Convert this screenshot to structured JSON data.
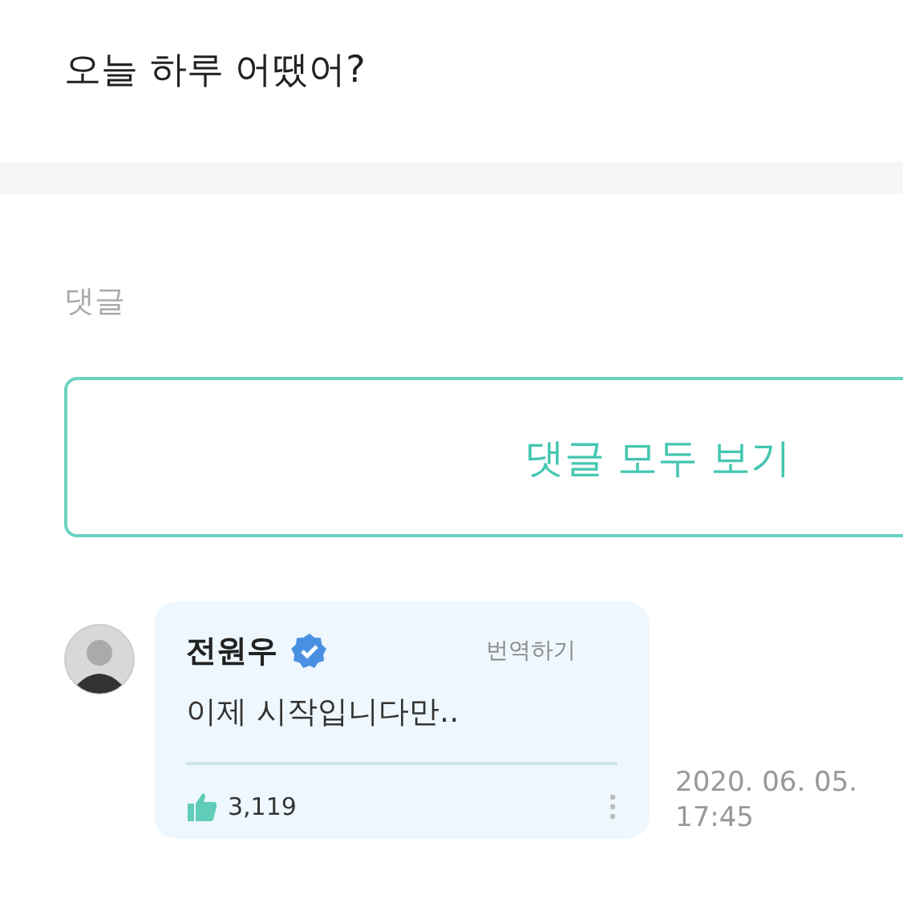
{
  "post": {
    "text": "오늘 하루 어땠어?"
  },
  "comments_section": {
    "heading": "댓글",
    "view_all_button": "댓글 모두 보기"
  },
  "comments": [
    {
      "author": "전원우",
      "verified": true,
      "translate": "번역하기",
      "text": "이제 시작입니다만..",
      "likes": "3,119",
      "date": "2020. 06. 05.",
      "time": "17:45"
    }
  ]
}
